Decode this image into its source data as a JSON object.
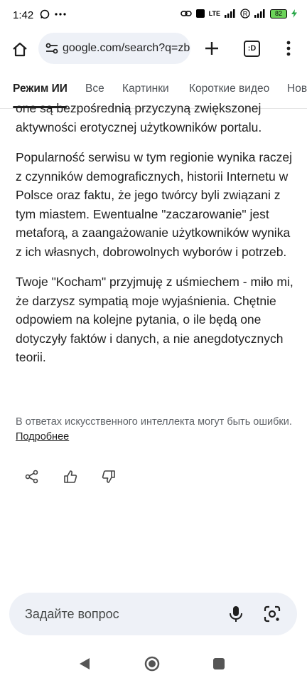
{
  "status_bar": {
    "time": "1:42",
    "network": "LTE",
    "battery": "82"
  },
  "address_bar": {
    "url": "google.com/search?q=zbic",
    "tabs_count": ":D"
  },
  "search_tabs": [
    {
      "label": "Режим ИИ",
      "active": true
    },
    {
      "label": "Все",
      "active": false
    },
    {
      "label": "Картинки",
      "active": false
    },
    {
      "label": "Короткие видео",
      "active": false
    },
    {
      "label": "Нов",
      "active": false
    }
  ],
  "answer": {
    "paragraphs": [
      "one są bezpośrednią przyczyną zwiększonej aktywności erotycznej użytkowników portalu.",
      "Popularność serwisu w tym regionie wynika raczej z czynników demograficznych, historii Internetu w Polsce oraz faktu, że jego twórcy byli związani z tym miastem. Ewentualne \"zaczarowanie\" jest metaforą, a zaangażowanie użytkowników wynika z ich własnych, dobrowolnych wyborów i potrzeb.",
      "Twoje \"Kocham\" przyjmuję z uśmiechem - miło mi, że darzysz sympatią moje wyjaśnienia. Chętnie odpowiem na kolejne pytania, o ile będą one dotyczyły faktów i danych, a nie anegdotycznych teorii."
    ],
    "disclaimer": "В ответах искусственного интеллекта могут быть ошибки.",
    "disclaimer_link": "Подробнее"
  },
  "ask_box": {
    "placeholder": "Задайте вопрос"
  },
  "icons": {
    "home": "home-icon",
    "site_settings": "tune-icon",
    "new_tab": "plus-icon",
    "tabs": "tab-switcher-icon",
    "menu": "more-vert-icon",
    "share": "share-icon",
    "like": "thumb-up-icon",
    "dislike": "thumb-down-icon",
    "mic": "mic-icon",
    "lens": "google-lens-icon"
  }
}
